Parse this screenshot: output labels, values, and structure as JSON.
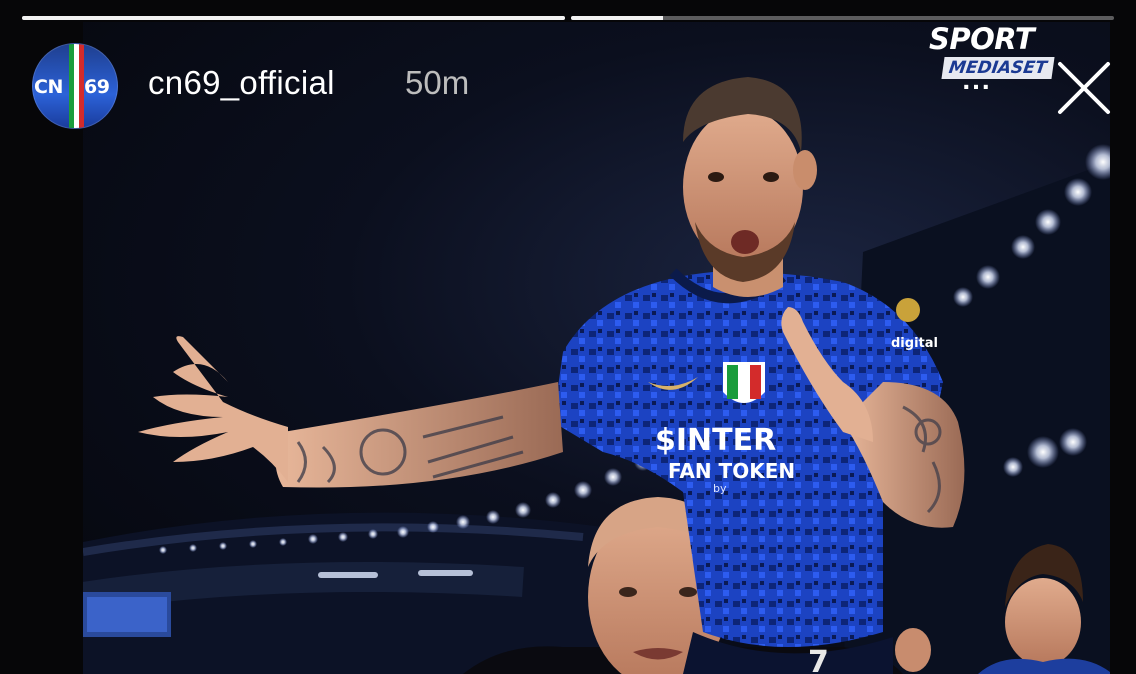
{
  "story": {
    "segments": [
      {
        "progress": 1.0
      },
      {
        "progress": 0.17
      }
    ]
  },
  "header": {
    "avatar_text_left": "CN",
    "avatar_text_right": "69",
    "username": "cn69_official",
    "time_ago": "50m",
    "more_label": "...",
    "close_icon": "close-icon"
  },
  "overlay": {
    "broadcaster_top": "SPORT",
    "broadcaster_bottom": "MEDIASET"
  },
  "photo": {
    "jersey_sponsor_line1": "$INTER",
    "jersey_sponsor_line2": "FAN TOKEN",
    "jersey_sponsor_line3": "by",
    "sleeve_text": "digital",
    "jersey_number": "7"
  },
  "colors": {
    "background": "#060608",
    "progress_track": "rgba(255,255,255,0.35)",
    "progress_fill": "#f2f2f2",
    "jersey_blue": "#1e49c8",
    "jersey_dark": "#0b1a4a",
    "timestamp": "#bdbdbd"
  }
}
